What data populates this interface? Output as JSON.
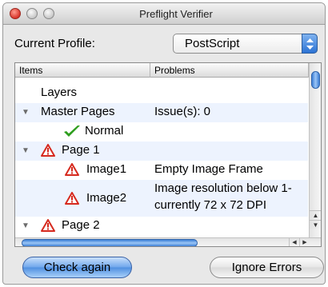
{
  "window": {
    "title": "Preflight Verifier"
  },
  "profile": {
    "label": "Current Profile:",
    "value": "PostScript"
  },
  "table": {
    "headers": [
      "Items",
      "Problems"
    ],
    "rows": [
      {
        "item": "Layers",
        "problem": ""
      },
      {
        "item": "Master Pages",
        "problem": "Issue(s): 0"
      },
      {
        "item": "Normal",
        "problem": ""
      },
      {
        "item": "Page 1",
        "problem": ""
      },
      {
        "item": "Image1",
        "problem": "Empty Image Frame"
      },
      {
        "item": "Image2",
        "problem": "Image resolution below 1-",
        "problem_line2": "currently 72 x 72 DPI"
      },
      {
        "item": "Page 2",
        "problem": ""
      }
    ]
  },
  "buttons": {
    "check_again": "Check again",
    "ignore_errors": "Ignore Errors"
  },
  "colors": {
    "accent": "#4f8fe0",
    "warning": "#d62a1f",
    "check": "#2e9e1e",
    "row_alt": "#edf3fe"
  },
  "icons": {
    "disclosure": "disclosure-triangle-icon",
    "warning": "warning-triangle-icon",
    "check": "checkmark-icon",
    "select": "up-down-arrows-icon"
  }
}
